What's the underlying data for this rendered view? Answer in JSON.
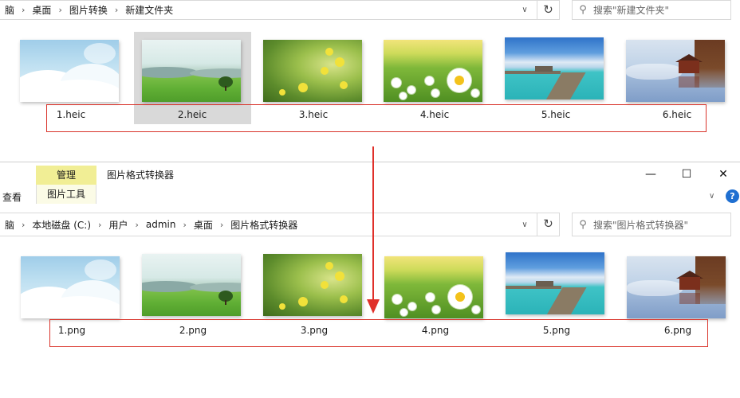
{
  "top_window": {
    "breadcrumbs": [
      "脑",
      "桌面",
      "图片转换",
      "新建文件夹"
    ],
    "search_placeholder": "搜索\"新建文件夹\"",
    "files": [
      "1.heic",
      "2.heic",
      "3.heic",
      "4.heic",
      "5.heic",
      "6.heic"
    ],
    "selected_index": 1
  },
  "bottom_window": {
    "title": "图片格式转换器",
    "ribbon_tabs": {
      "view": "查看",
      "manage": "管理",
      "picture_tools": "图片工具"
    },
    "breadcrumbs": [
      "脑",
      "本地磁盘 (C:)",
      "用户",
      "admin",
      "桌面",
      "图片格式转换器"
    ],
    "search_placeholder": "搜索\"图片格式转换器\"",
    "files": [
      "1.png",
      "2.png",
      "3.png",
      "4.png",
      "5.png",
      "6.png"
    ]
  },
  "icons": {
    "separator": "›",
    "dropdown": "∨",
    "refresh": "↻",
    "search": "⚲",
    "minimize": "—",
    "maximize": "☐",
    "close": "✕",
    "help": "?"
  },
  "colors": {
    "annotation_red": "#d9342b",
    "context_tab_yellow": "#f1ee95",
    "selection_gray": "#d9d9d9",
    "help_blue": "#1f6fd1"
  }
}
